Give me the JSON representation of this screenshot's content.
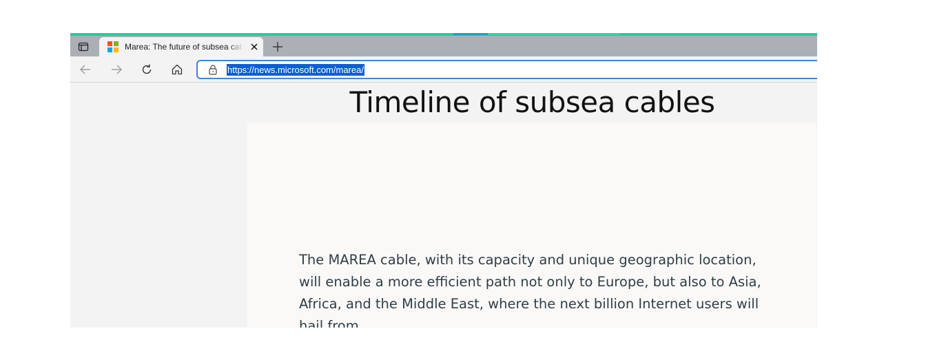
{
  "browser": {
    "tab": {
      "title": "Marea: The future of subsea cabl",
      "close_icon": "close-icon",
      "favicon": "microsoft-logo",
      "favicon_colors": [
        "#f25022",
        "#7fba00",
        "#00a4ef",
        "#ffb900"
      ]
    },
    "new_tab_icon": "plus-icon",
    "tab_actions_icon": "tab-actions-icon",
    "address_bar": {
      "url": "https://news.microsoft.com/marea/",
      "lock_icon": "lock-icon"
    },
    "nav_icons": [
      "back-arrow-icon",
      "forward-arrow-icon",
      "refresh-icon",
      "home-icon"
    ],
    "accent_color": "#1fcf9f",
    "selection_color": "#0a5fd8"
  },
  "page": {
    "title": "Timeline of subsea cables",
    "body_text": "The MAREA cable, with its capacity and unique geographic location, will enable a more efficient path not only to Europe, but also to Asia, Africa, and the Middle East, where the next billion Internet users will hail from."
  }
}
